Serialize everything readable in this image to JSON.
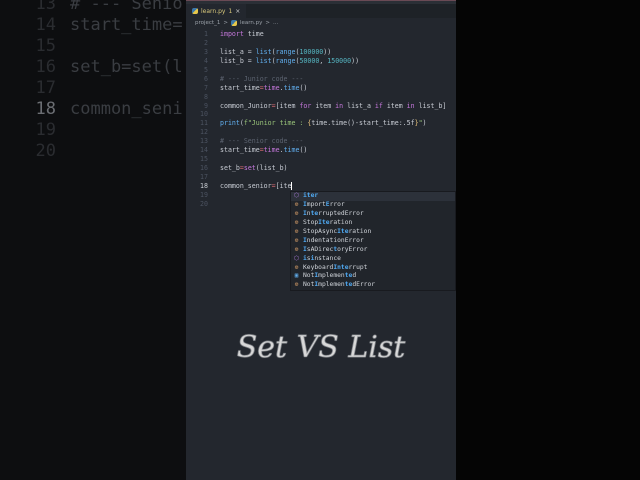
{
  "tab": {
    "filename": "learn.py",
    "badge": "1",
    "close": "×"
  },
  "breadcrumb": {
    "folder": "project_1",
    "sep": ">",
    "file": "learn.py",
    "more": "..."
  },
  "lines": [
    {
      "n": "1",
      "html": "<span class='kw'>import</span> time"
    },
    {
      "n": "2",
      "html": ""
    },
    {
      "n": "3",
      "html": "list_a = <span class='fn'>list</span>(<span class='fn'>range</span>(<span class='num'>100000</span>))"
    },
    {
      "n": "4",
      "html": "list_b = <span class='fn'>list</span>(<span class='fn'>range</span>(<span class='num'>50000</span>, <span class='num'>150000</span>))"
    },
    {
      "n": "5",
      "html": ""
    },
    {
      "n": "6",
      "html": "<span class='cm'># --- Junior code ---</span>"
    },
    {
      "n": "7",
      "html": "start_time<span class='op'>=</span><span class='kw'>time</span>.<span class='fn'>time</span>()"
    },
    {
      "n": "8",
      "html": ""
    },
    {
      "n": "9",
      "html": "common_Junior<span class='op'>=</span>[item <span class='kw'>for</span> item <span class='kw'>in</span> list_a <span class='kw'>if</span> item <span class='kw'>in</span> list_b]"
    },
    {
      "n": "10",
      "html": ""
    },
    {
      "n": "11",
      "html": "<span class='fn'>print</span>(<span class='st'>f\"Junior time : </span><span class='br'>{</span>time.time()-start_time:.5f<span class='br'>}</span><span class='st'>\"</span>)"
    },
    {
      "n": "12",
      "html": ""
    },
    {
      "n": "13",
      "html": "<span class='cm'># --- Senior code ---</span>"
    },
    {
      "n": "14",
      "html": "start_time<span class='op'>=</span><span class='kw'>time</span>.<span class='fn'>time</span>()"
    },
    {
      "n": "15",
      "html": ""
    },
    {
      "n": "16",
      "html": "set_b<span class='op'>=</span><span class='kw'>set</span>(list_b)"
    },
    {
      "n": "17",
      "html": ""
    },
    {
      "n": "18",
      "html": "common_senior<span class='op'>=</span>[ite"
    },
    {
      "n": "19",
      "html": ""
    },
    {
      "n": "20",
      "html": ""
    }
  ],
  "autocomplete": [
    {
      "pre": "",
      "m": "iter",
      "post": "",
      "kind": "function"
    },
    {
      "pre": "",
      "m": "I",
      "post": "mport",
      "m2": "E",
      "post2": "rror",
      "kind": "class"
    },
    {
      "pre": "",
      "m": "I",
      "post": "n",
      "m2": "te",
      "post2": "rruptedError",
      "kind": "class"
    },
    {
      "pre": "Stop",
      "m": "Ite",
      "post": "ration",
      "kind": "class"
    },
    {
      "pre": "StopAsync",
      "m": "Ite",
      "post": "ration",
      "kind": "class"
    },
    {
      "pre": "",
      "m": "I",
      "post": "ndentationError",
      "kind": "class"
    },
    {
      "pre": "",
      "m": "I",
      "post": "sADirec",
      "m2": "t",
      "post2": "oryError",
      "kind": "class"
    },
    {
      "pre": "",
      "m": "i",
      "post": "s",
      "m2": "i",
      "post2": "nstance",
      "kind": "function"
    },
    {
      "pre": "Keyboard",
      "m": "Inte",
      "post": "rrupt",
      "kind": "class"
    },
    {
      "pre": "Not",
      "m": "I",
      "post": "mplemen",
      "m2": "te",
      "post2": "d",
      "kind": "constant"
    },
    {
      "pre": "Not",
      "m": "I",
      "post": "mplemen",
      "m2": "te",
      "post2": "dError",
      "kind": "class"
    }
  ],
  "overlay_title": "Set VS List",
  "bg_lines": [
    {
      "n": "13",
      "text": "# --- Senio"
    },
    {
      "n": "14",
      "text": "start_time="
    },
    {
      "n": "15",
      "text": ""
    },
    {
      "n": "16",
      "text": "set_b=set(l"
    },
    {
      "n": "17",
      "text": ""
    },
    {
      "n": "18",
      "text": "common_seni"
    },
    {
      "n": "19",
      "text": ""
    },
    {
      "n": "20",
      "text": ""
    }
  ]
}
